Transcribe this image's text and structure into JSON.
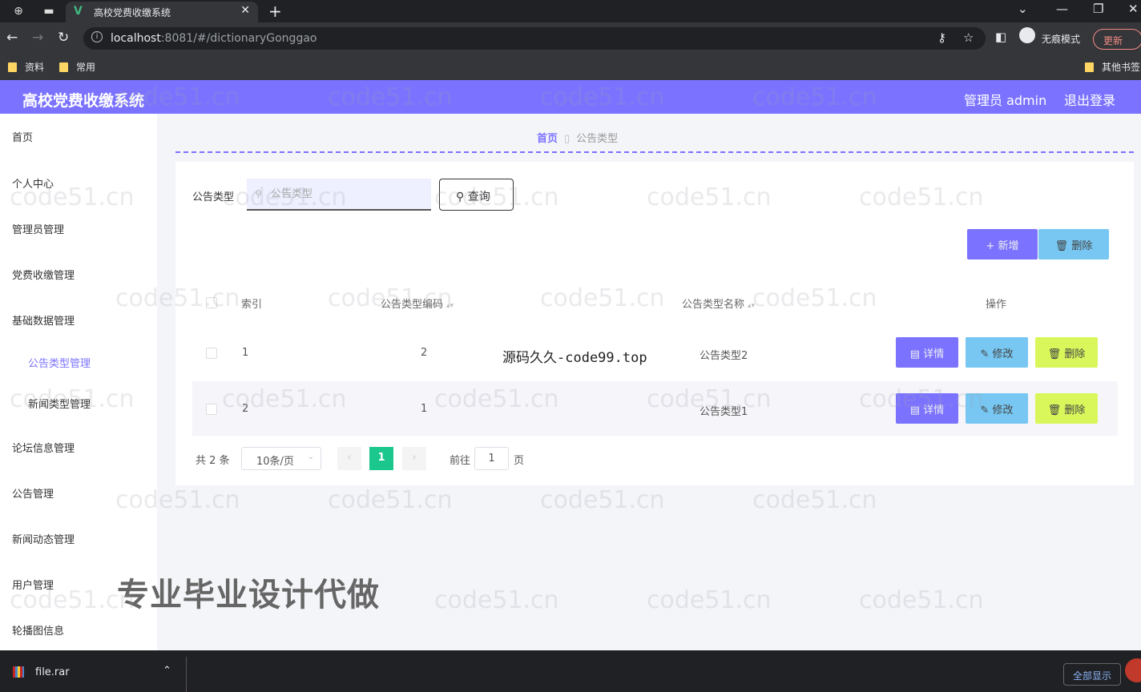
{
  "browser": {
    "tab_title": "高校党费收缴系统",
    "url_host": "localhost",
    "url_rest": ":8081/#/dictionaryGonggao",
    "incognito_label": "无痕模式",
    "update_label": "更新",
    "bookmarks": [
      "资料",
      "常用"
    ],
    "other_bookmarks": "其他书签"
  },
  "header": {
    "title": "高校党费收缴系统",
    "admin_label": "管理员 admin",
    "logout_label": "退出登录"
  },
  "sidebar": {
    "items": [
      {
        "label": "首页"
      },
      {
        "label": "个人中心"
      },
      {
        "label": "管理员管理"
      },
      {
        "label": "党费收缴管理"
      },
      {
        "label": "基础数据管理"
      },
      {
        "label": "公告类型管理"
      },
      {
        "label": "新闻类型管理"
      },
      {
        "label": "论坛信息管理"
      },
      {
        "label": "公告管理"
      },
      {
        "label": "新闻动态管理"
      },
      {
        "label": "用户管理"
      },
      {
        "label": "轮播图信息"
      }
    ]
  },
  "breadcrumb": {
    "home": "首页",
    "current": "公告类型"
  },
  "search": {
    "label": "公告类型",
    "placeholder": "公告类型",
    "query_label": "查询"
  },
  "toolbar": {
    "add_label": "+ 新增",
    "delete_label": "删除"
  },
  "table": {
    "headers": {
      "index": "索引",
      "code": "公告类型编码",
      "name": "公告类型名称",
      "actions": "操作"
    },
    "rows": [
      {
        "index": "1",
        "code": "2",
        "name": "公告类型2"
      },
      {
        "index": "2",
        "code": "1",
        "name": "公告类型1"
      }
    ],
    "action_labels": {
      "detail": "详情",
      "edit": "修改",
      "delete": "删除"
    }
  },
  "pagination": {
    "total": "共 2 条",
    "page_size": "10条/页",
    "current_page": "1",
    "goto_label": "前往",
    "goto_value": "1",
    "goto_suffix": "页"
  },
  "overlay": {
    "source_watermark": "源码久久-code99.top",
    "promo": "专业毕业设计代做",
    "repeating_watermark": "code51.cn"
  },
  "download_bar": {
    "file_name": "file.rar",
    "show_all_label": "全部显示"
  },
  "colors": {
    "accent": "#7b73ff",
    "edit": "#77c7f2",
    "delete": "#d9f75b",
    "pager_active": "#1bc78c"
  }
}
